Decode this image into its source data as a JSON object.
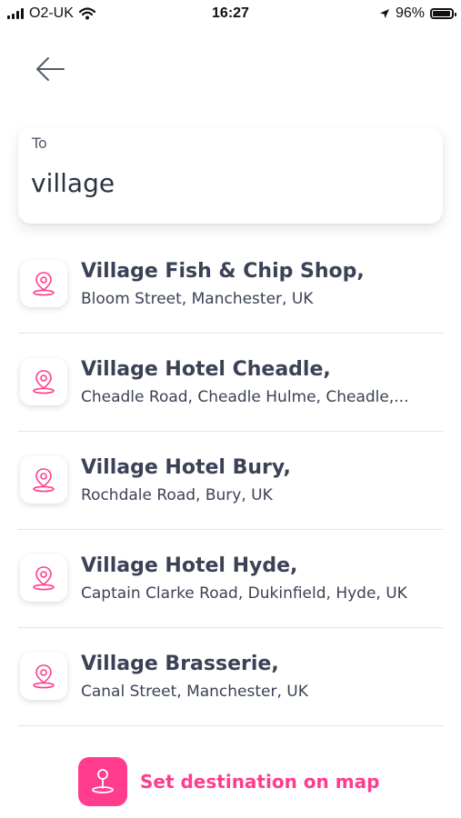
{
  "status_bar": {
    "carrier": "O2-UK",
    "time": "16:27",
    "battery_percent": "96%",
    "battery_level": 0.96
  },
  "header": {
    "back_icon": "arrow-left-icon"
  },
  "search": {
    "label": "To",
    "value": "village"
  },
  "results": [
    {
      "title": "Village Fish & Chip Shop,",
      "subtitle": "Bloom Street, Manchester, UK"
    },
    {
      "title": "Village Hotel Cheadle,",
      "subtitle": "Cheadle Road, Cheadle Hulme, Cheadle,..."
    },
    {
      "title": "Village Hotel Bury,",
      "subtitle": "Rochdale Road, Bury, UK"
    },
    {
      "title": "Village Hotel Hyde,",
      "subtitle": "Captain Clarke Road, Dukinfield, Hyde, UK"
    },
    {
      "title": "Village Brasserie,",
      "subtitle": "Canal Street, Manchester, UK"
    }
  ],
  "footer": {
    "set_destination_label": "Set destination on map"
  },
  "colors": {
    "accent": "#ff3c8e",
    "text": "#3b4256",
    "divider": "#e3e4e7"
  }
}
